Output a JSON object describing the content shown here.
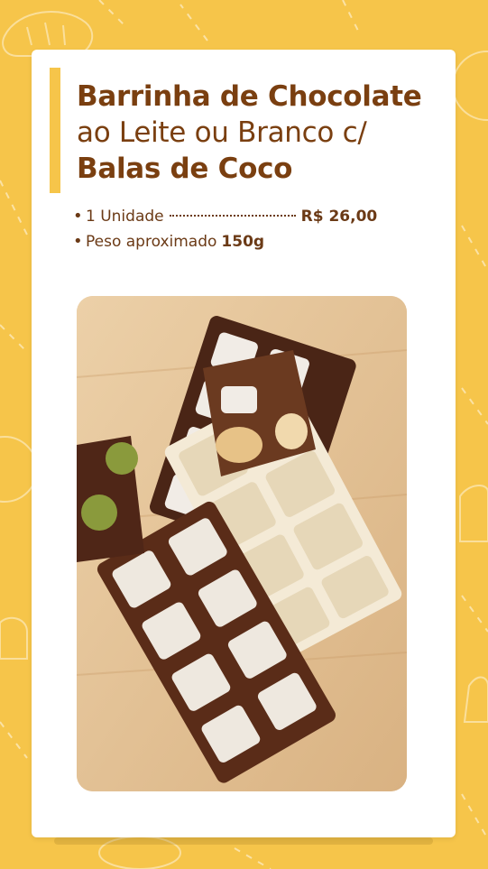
{
  "product": {
    "title_line1": "Barrinha de Chocolate",
    "title_line2": "ao Leite ou Branco c/",
    "title_line3": "Balas de Coco",
    "details": [
      {
        "label": "1 Unidade",
        "value": "R$ 26,00"
      },
      {
        "label": "Peso aproximado",
        "value": "150g"
      }
    ]
  },
  "image": {
    "subject": "chocolate-bars-photo"
  },
  "colors": {
    "background": "#f6c54a",
    "card": "#ffffff",
    "text": "#7a3f10"
  }
}
